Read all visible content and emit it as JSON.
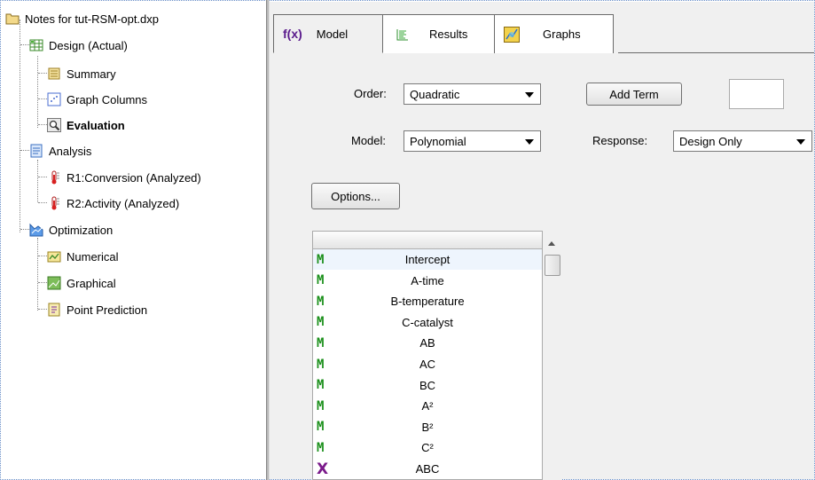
{
  "tree": {
    "root": "Notes for tut-RSM-opt.dxp",
    "items": [
      {
        "label": "Design (Actual)",
        "icon": "grid-icon",
        "bold": false
      },
      {
        "label": "Summary",
        "icon": "summary-icon",
        "bold": false
      },
      {
        "label": "Graph Columns",
        "icon": "scatter-icon",
        "bold": false
      },
      {
        "label": "Evaluation",
        "icon": "magnifier-icon",
        "bold": true
      },
      {
        "label": "Analysis",
        "icon": "analysis-icon",
        "bold": false
      },
      {
        "label": "R1:Conversion (Analyzed)",
        "icon": "thermometer-icon",
        "bold": false
      },
      {
        "label": "R2:Activity (Analyzed)",
        "icon": "thermometer-icon",
        "bold": false
      },
      {
        "label": "Optimization",
        "icon": "optimization-icon",
        "bold": false
      },
      {
        "label": "Numerical",
        "icon": "numerical-icon",
        "bold": false
      },
      {
        "label": "Graphical",
        "icon": "graphical-icon",
        "bold": false
      },
      {
        "label": "Point Prediction",
        "icon": "prediction-icon",
        "bold": false
      }
    ]
  },
  "tabs": {
    "model_prefix": "f(x)",
    "model": "Model",
    "results": "Results",
    "graphs": "Graphs",
    "active": "Model"
  },
  "form": {
    "order_label": "Order:",
    "order_value": "Quadratic",
    "model_label": "Model:",
    "model_value": "Polynomial",
    "add_term": "Add Term",
    "response_label": "Response:",
    "response_value": "Design Only",
    "options": "Options..."
  },
  "terms": [
    {
      "name": "Intercept",
      "mark": "M"
    },
    {
      "name": "A-time",
      "mark": "M"
    },
    {
      "name": "B-temperature",
      "mark": "M"
    },
    {
      "name": "C-catalyst",
      "mark": "M"
    },
    {
      "name": "AB",
      "mark": "M"
    },
    {
      "name": "AC",
      "mark": "M"
    },
    {
      "name": "BC",
      "mark": "M"
    },
    {
      "name": "A²",
      "mark": "M"
    },
    {
      "name": "B²",
      "mark": "M"
    },
    {
      "name": "C²",
      "mark": "M"
    },
    {
      "name": "ABC",
      "mark": "X"
    }
  ],
  "colors": {
    "model_mark": "#1a8f1a",
    "excluded_mark": "#7a1a8a",
    "fx": "#5a1a8c"
  }
}
